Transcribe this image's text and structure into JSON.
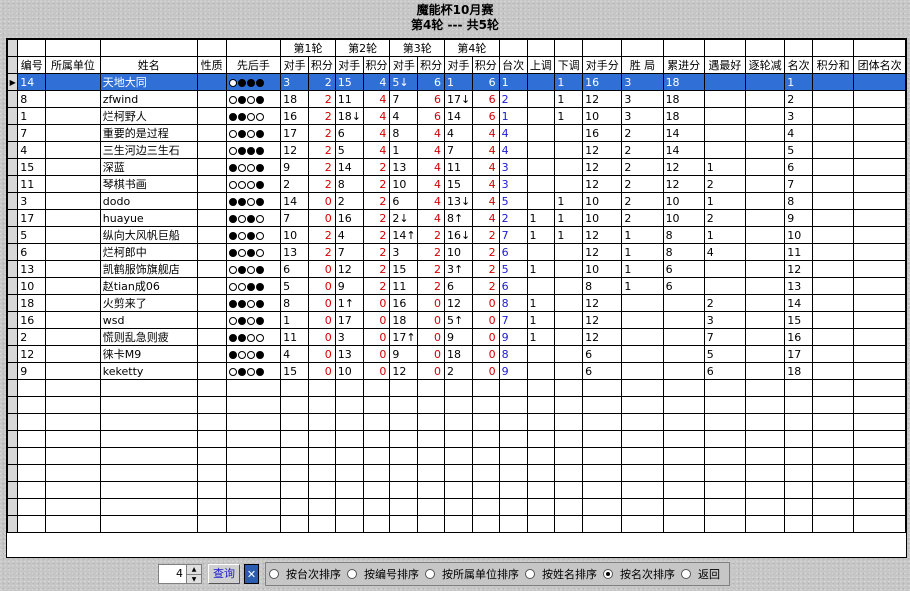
{
  "title": {
    "line1": "魔能杯10月赛",
    "line2": "第4轮 --- 共5轮"
  },
  "round_headers": [
    "第1轮",
    "第2轮",
    "第3轮",
    "第4轮"
  ],
  "columns": [
    "编号",
    "所属单位",
    "姓名",
    "性质",
    "先后手",
    "对手",
    "积分",
    "对手",
    "积分",
    "对手",
    "积分",
    "对手",
    "积分",
    "台次",
    "上调",
    "下调",
    "对手分",
    "胜  局",
    "累进分",
    "遇最好",
    "逐轮减",
    "名次",
    "积分和",
    "团体名次"
  ],
  "rows": [
    {
      "id": "14",
      "unit": "",
      "name": "天地大同",
      "nature": "",
      "stones": "wbbb",
      "r1o": "3",
      "r1s": "2",
      "r2o": "15",
      "r2s": "4",
      "r3o": "5↓",
      "r3s": "6",
      "r4o": "1",
      "r4s": "6",
      "table": "1",
      "up": "",
      "down": "1",
      "opp": "16",
      "win": "3",
      "cum": "18",
      "best": "",
      "dec": "",
      "rank": "1",
      "sum": "",
      "team": "",
      "selected": true
    },
    {
      "id": "8",
      "unit": "",
      "name": "zfwind",
      "nature": "",
      "stones": "wbwb",
      "r1o": "18",
      "r1s": "2",
      "r2o": "11",
      "r2s": "4",
      "r3o": "7",
      "r3s": "6",
      "r4o": "17↓",
      "r4s": "6",
      "table": "2",
      "up": "",
      "down": "1",
      "opp": "12",
      "win": "3",
      "cum": "18",
      "best": "",
      "dec": "",
      "rank": "2",
      "sum": "",
      "team": ""
    },
    {
      "id": "1",
      "unit": "",
      "name": "烂柯野人",
      "nature": "",
      "stones": "bbww",
      "r1o": "16",
      "r1s": "2",
      "r2o": "18↓",
      "r2s": "4",
      "r3o": "4",
      "r3s": "6",
      "r4o": "14",
      "r4s": "6",
      "table": "1",
      "up": "",
      "down": "1",
      "opp": "10",
      "win": "3",
      "cum": "18",
      "best": "",
      "dec": "",
      "rank": "3",
      "sum": "",
      "team": ""
    },
    {
      "id": "7",
      "unit": "",
      "name": "重要的是过程",
      "nature": "",
      "stones": "wbwb",
      "r1o": "17",
      "r1s": "2",
      "r2o": "6",
      "r2s": "4",
      "r3o": "8",
      "r3s": "4",
      "r4o": "4",
      "r4s": "4",
      "table": "4",
      "up": "",
      "down": "",
      "opp": "16",
      "win": "2",
      "cum": "14",
      "best": "",
      "dec": "",
      "rank": "4",
      "sum": "",
      "team": ""
    },
    {
      "id": "4",
      "unit": "",
      "name": "三生河边三生石",
      "nature": "",
      "stones": "wbbb",
      "r1o": "12",
      "r1s": "2",
      "r2o": "5",
      "r2s": "4",
      "r3o": "1",
      "r3s": "4",
      "r4o": "7",
      "r4s": "4",
      "table": "4",
      "up": "",
      "down": "",
      "opp": "12",
      "win": "2",
      "cum": "14",
      "best": "",
      "dec": "",
      "rank": "5",
      "sum": "",
      "team": ""
    },
    {
      "id": "15",
      "unit": "",
      "name": "深蓝",
      "nature": "",
      "stones": "bwwb",
      "r1o": "9",
      "r1s": "2",
      "r2o": "14",
      "r2s": "2",
      "r3o": "13",
      "r3s": "4",
      "r4o": "11",
      "r4s": "4",
      "table": "3",
      "up": "",
      "down": "",
      "opp": "12",
      "win": "2",
      "cum": "12",
      "best": "1",
      "dec": "",
      "rank": "6",
      "sum": "",
      "team": ""
    },
    {
      "id": "11",
      "unit": "",
      "name": "琴棋书画",
      "nature": "",
      "stones": "wwwb",
      "r1o": "2",
      "r1s": "2",
      "r2o": "8",
      "r2s": "2",
      "r3o": "10",
      "r3s": "4",
      "r4o": "15",
      "r4s": "4",
      "table": "3",
      "up": "",
      "down": "",
      "opp": "12",
      "win": "2",
      "cum": "12",
      "best": "2",
      "dec": "",
      "rank": "7",
      "sum": "",
      "team": ""
    },
    {
      "id": "3",
      "unit": "",
      "name": "dodo",
      "nature": "",
      "stones": "bbwb",
      "r1o": "14",
      "r1s": "0",
      "r2o": "2",
      "r2s": "2",
      "r3o": "6",
      "r3s": "4",
      "r4o": "13↓",
      "r4s": "4",
      "table": "5",
      "up": "",
      "down": "1",
      "opp": "10",
      "win": "2",
      "cum": "10",
      "best": "1",
      "dec": "",
      "rank": "8",
      "sum": "",
      "team": ""
    },
    {
      "id": "17",
      "unit": "",
      "name": "huayue",
      "nature": "",
      "stones": "bwbw",
      "r1o": "7",
      "r1s": "0",
      "r2o": "16",
      "r2s": "2",
      "r3o": "2↓",
      "r3s": "4",
      "r4o": "8↑",
      "r4s": "4",
      "table": "2",
      "up": "1",
      "down": "1",
      "opp": "10",
      "win": "2",
      "cum": "10",
      "best": "2",
      "dec": "",
      "rank": "9",
      "sum": "",
      "team": ""
    },
    {
      "id": "5",
      "unit": "",
      "name": "纵向大风帆巨船",
      "nature": "",
      "stones": "bwbw",
      "r1o": "10",
      "r1s": "2",
      "r2o": "4",
      "r2s": "2",
      "r3o": "14↑",
      "r3s": "2",
      "r4o": "16↓",
      "r4s": "2",
      "table": "7",
      "up": "1",
      "down": "1",
      "opp": "12",
      "win": "1",
      "cum": "8",
      "best": "1",
      "dec": "",
      "rank": "10",
      "sum": "",
      "team": ""
    },
    {
      "id": "6",
      "unit": "",
      "name": "烂柯郎中",
      "nature": "",
      "stones": "bwbw",
      "r1o": "13",
      "r1s": "2",
      "r2o": "7",
      "r2s": "2",
      "r3o": "3",
      "r3s": "2",
      "r4o": "10",
      "r4s": "2",
      "table": "6",
      "up": "",
      "down": "",
      "opp": "12",
      "win": "1",
      "cum": "8",
      "best": "4",
      "dec": "",
      "rank": "11",
      "sum": "",
      "team": ""
    },
    {
      "id": "13",
      "unit": "",
      "name": "凯鹤服饰旗舰店",
      "nature": "",
      "stones": "wbwb",
      "r1o": "6",
      "r1s": "0",
      "r2o": "12",
      "r2s": "2",
      "r3o": "15",
      "r3s": "2",
      "r4o": "3↑",
      "r4s": "2",
      "table": "5",
      "up": "1",
      "down": "",
      "opp": "10",
      "win": "1",
      "cum": "6",
      "best": "",
      "dec": "",
      "rank": "12",
      "sum": "",
      "team": ""
    },
    {
      "id": "10",
      "unit": "",
      "name": "赵tian成06",
      "nature": "",
      "stones": "wwbb",
      "r1o": "5",
      "r1s": "0",
      "r2o": "9",
      "r2s": "2",
      "r3o": "11",
      "r3s": "2",
      "r4o": "6",
      "r4s": "2",
      "table": "6",
      "up": "",
      "down": "",
      "opp": "8",
      "win": "1",
      "cum": "6",
      "best": "",
      "dec": "",
      "rank": "13",
      "sum": "",
      "team": ""
    },
    {
      "id": "18",
      "unit": "",
      "name": "火剪来了",
      "nature": "",
      "stones": "bbwb",
      "r1o": "8",
      "r1s": "0",
      "r2o": "1↑",
      "r2s": "0",
      "r3o": "16",
      "r3s": "0",
      "r4o": "12",
      "r4s": "0",
      "table": "8",
      "up": "1",
      "down": "",
      "opp": "12",
      "win": "",
      "cum": "",
      "best": "2",
      "dec": "",
      "rank": "14",
      "sum": "",
      "team": ""
    },
    {
      "id": "16",
      "unit": "",
      "name": "wsd",
      "nature": "",
      "stones": "wbwb",
      "r1o": "1",
      "r1s": "0",
      "r2o": "17",
      "r2s": "0",
      "r3o": "18",
      "r3s": "0",
      "r4o": "5↑",
      "r4s": "0",
      "table": "7",
      "up": "1",
      "down": "",
      "opp": "12",
      "win": "",
      "cum": "",
      "best": "3",
      "dec": "",
      "rank": "15",
      "sum": "",
      "team": ""
    },
    {
      "id": "2",
      "unit": "",
      "name": "慌则乱急则疲",
      "nature": "",
      "stones": "bbww",
      "r1o": "11",
      "r1s": "0",
      "r2o": "3",
      "r2s": "0",
      "r3o": "17↑",
      "r3s": "0",
      "r4o": "9",
      "r4s": "0",
      "table": "9",
      "up": "1",
      "down": "",
      "opp": "12",
      "win": "",
      "cum": "",
      "best": "7",
      "dec": "",
      "rank": "16",
      "sum": "",
      "team": ""
    },
    {
      "id": "12",
      "unit": "",
      "name": "徕卡M9",
      "nature": "",
      "stones": "bwwb",
      "r1o": "4",
      "r1s": "0",
      "r2o": "13",
      "r2s": "0",
      "r3o": "9",
      "r3s": "0",
      "r4o": "18",
      "r4s": "0",
      "table": "8",
      "up": "",
      "down": "",
      "opp": "6",
      "win": "",
      "cum": "",
      "best": "5",
      "dec": "",
      "rank": "17",
      "sum": "",
      "team": ""
    },
    {
      "id": "9",
      "unit": "",
      "name": "keketty",
      "nature": "",
      "stones": "wbwb",
      "r1o": "15",
      "r1s": "0",
      "r2o": "10",
      "r2s": "0",
      "r3o": "12",
      "r3s": "0",
      "r4o": "2",
      "r4s": "0",
      "table": "9",
      "up": "",
      "down": "",
      "opp": "6",
      "win": "",
      "cum": "",
      "best": "6",
      "dec": "",
      "rank": "18",
      "sum": "",
      "team": ""
    }
  ],
  "bottom": {
    "round_value": "4",
    "query_label": "查询",
    "x_icon": "close-icon",
    "radios": [
      {
        "label": "按台次排序",
        "checked": false
      },
      {
        "label": "按编号排序",
        "checked": false
      },
      {
        "label": "按所属单位排序",
        "checked": false
      },
      {
        "label": "按姓名排序",
        "checked": false
      },
      {
        "label": "按名次排序",
        "checked": true
      },
      {
        "label": "返回",
        "checked": false
      }
    ]
  },
  "colors": {
    "selection": "#2f6fd6",
    "score_red": "#d40000",
    "table_blue": "#1a1ad0"
  }
}
